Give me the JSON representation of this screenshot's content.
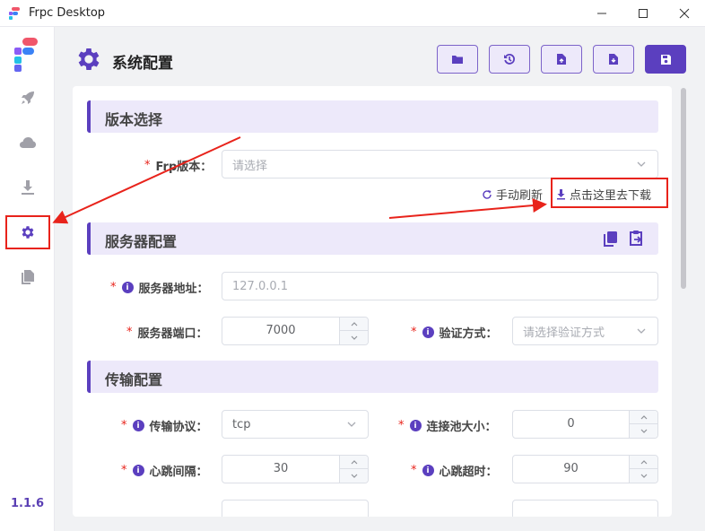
{
  "window": {
    "title": "Frpc Desktop"
  },
  "sidebar": {
    "items": [
      {
        "icon": "rocket-icon"
      },
      {
        "icon": "cloud-icon"
      },
      {
        "icon": "download-icon"
      },
      {
        "icon": "gear-icon",
        "active": true
      },
      {
        "icon": "files-icon"
      }
    ],
    "version": "1.1.6"
  },
  "header": {
    "title": "系统配置",
    "buttons": [
      {
        "icon": "folder-icon"
      },
      {
        "icon": "history-icon"
      },
      {
        "icon": "file-export-icon"
      },
      {
        "icon": "file-import-icon"
      },
      {
        "icon": "save-icon",
        "primary": true
      }
    ]
  },
  "sections": {
    "version": {
      "title": "版本选择",
      "frp_label": "Frp版本：",
      "frp_placeholder": "请选择",
      "refresh_label": "手动刷新",
      "download_label": "点击这里去下载"
    },
    "server": {
      "title": "服务器配置",
      "addr_label": "服务器地址：",
      "addr_placeholder": "127.0.0.1",
      "port_label": "服务器端口：",
      "port_value": "7000",
      "auth_label": "验证方式：",
      "auth_placeholder": "请选择验证方式"
    },
    "transport": {
      "title": "传输配置",
      "protocol_label": "传输协议：",
      "protocol_value": "tcp",
      "pool_label": "连接池大小：",
      "pool_value": "0",
      "heartbeat_interval_label": "心跳间隔：",
      "heartbeat_interval_value": "30",
      "heartbeat_timeout_label": "心跳超时：",
      "heartbeat_timeout_value": "90"
    }
  },
  "colors": {
    "accent": "#5b3fbf",
    "accent_light": "#ede9fa",
    "annotation": "#e8231b"
  }
}
